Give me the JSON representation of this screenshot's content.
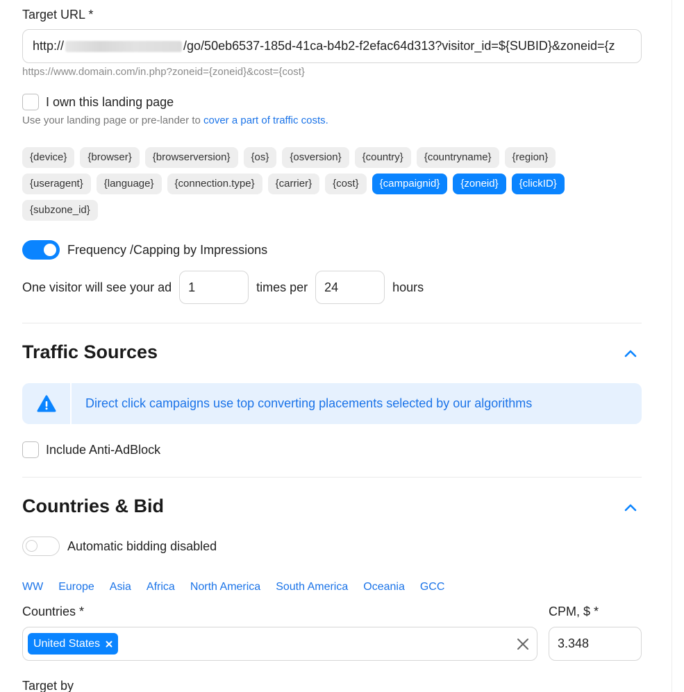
{
  "target_url": {
    "label": "Target URL *",
    "value_prefix": "http://",
    "value_suffix": "/go/50eb6537-185d-41ca-b4b2-f2efac64d313?visitor_id=${SUBID}&zoneid={z",
    "hint": "https://www.domain.com/in.php?zoneid={zoneid}&cost={cost}"
  },
  "own_landing": {
    "label": "I own this landing page",
    "note_text": "Use your landing page or pre-lander to ",
    "note_link": "cover a part of traffic costs."
  },
  "tags": [
    {
      "label": "{device}",
      "active": false
    },
    {
      "label": "{browser}",
      "active": false
    },
    {
      "label": "{browserversion}",
      "active": false
    },
    {
      "label": "{os}",
      "active": false
    },
    {
      "label": "{osversion}",
      "active": false
    },
    {
      "label": "{country}",
      "active": false
    },
    {
      "label": "{countryname}",
      "active": false
    },
    {
      "label": "{region}",
      "active": false
    },
    {
      "label": "{useragent}",
      "active": false
    },
    {
      "label": "{language}",
      "active": false
    },
    {
      "label": "{connection.type}",
      "active": false
    },
    {
      "label": "{carrier}",
      "active": false
    },
    {
      "label": "{cost}",
      "active": false
    },
    {
      "label": "{campaignid}",
      "active": true
    },
    {
      "label": "{zoneid}",
      "active": true
    },
    {
      "label": "{clickID}",
      "active": true
    },
    {
      "label": "{subzone_id}",
      "active": false
    }
  ],
  "frequency": {
    "toggle_label": "Frequency /Capping by Impressions",
    "enabled": true,
    "prefix": "One visitor will see your ad",
    "times_value": "1",
    "middle": "times per",
    "hours_value": "24",
    "suffix": "hours"
  },
  "traffic_sources": {
    "title": "Traffic Sources",
    "info_text": "Direct click campaigns use top converting placements selected by our algorithms",
    "adblock_label": "Include Anti-AdBlock"
  },
  "countries_bid": {
    "title": "Countries & Bid",
    "auto_bidding_label": "Automatic bidding disabled",
    "auto_bidding_enabled": false,
    "regions": [
      "WW",
      "Europe",
      "Asia",
      "Africa",
      "North America",
      "South America",
      "Oceania",
      "GCC"
    ],
    "countries_label": "Countries *",
    "selected_country": "United States",
    "cpm_label": "CPM, $ *",
    "cpm_value": "3.348",
    "target_by_label": "Target by"
  },
  "colors": {
    "accent": "#0a84ff",
    "link": "#1a73e8",
    "info_bg": "#e6f1fe"
  }
}
